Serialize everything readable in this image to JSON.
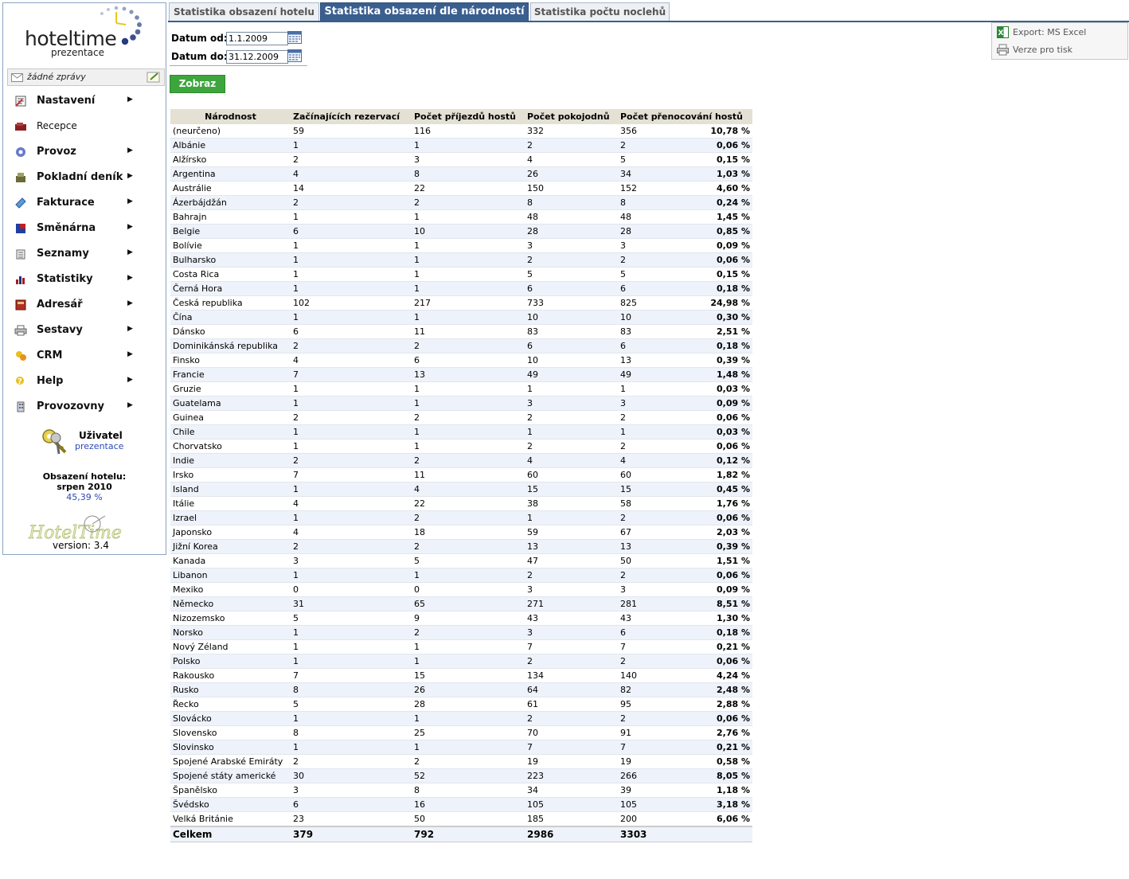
{
  "brand": {
    "name": "hoteltime",
    "sub": "prezentace"
  },
  "messages": {
    "text": "žádné zprávy"
  },
  "menu": [
    {
      "label": "Nastavení",
      "icon": "settings-icon",
      "submenu": true
    },
    {
      "label": "Recepce",
      "icon": "reception-icon",
      "submenu": false
    },
    {
      "label": "Provoz",
      "icon": "gear-icon",
      "submenu": true
    },
    {
      "label": "Pokladní deník",
      "icon": "cash-register-icon",
      "submenu": true
    },
    {
      "label": "Fakturace",
      "icon": "invoice-icon",
      "submenu": true
    },
    {
      "label": "Směnárna",
      "icon": "exchange-flag-icon",
      "submenu": true
    },
    {
      "label": "Seznamy",
      "icon": "list-icon",
      "submenu": true
    },
    {
      "label": "Statistiky",
      "icon": "bar-chart-icon",
      "submenu": true
    },
    {
      "label": "Adresář",
      "icon": "address-book-icon",
      "submenu": true
    },
    {
      "label": "Sestavy",
      "icon": "printer-icon",
      "submenu": true
    },
    {
      "label": "CRM",
      "icon": "crm-icon",
      "submenu": true
    },
    {
      "label": "Help",
      "icon": "help-icon",
      "submenu": true
    },
    {
      "label": "Provozovny",
      "icon": "building-icon",
      "submenu": true
    }
  ],
  "user": {
    "title": "Uživatel",
    "name": "prezentace"
  },
  "occupancy": {
    "line1": "Obsazení hotelu:",
    "line2": "srpen 2010",
    "value": "45,39 %"
  },
  "version": {
    "text": "version: 3.4",
    "logo": "HotelTime"
  },
  "tabs": [
    {
      "label": "Statistika obsazení hotelu",
      "active": false
    },
    {
      "label": "Statistika obsazení dle národností",
      "active": true
    },
    {
      "label": "Statistika počtu noclehů",
      "active": false
    }
  ],
  "filter": {
    "from_label": "Datum od:",
    "from_value": "1.1.2009",
    "to_label": "Datum do:",
    "to_value": "31.12.2009",
    "submit": "Zobraz"
  },
  "export": {
    "excel": "Export: MS Excel",
    "print": "Verze pro tisk"
  },
  "table": {
    "columns": [
      "Národnost",
      "Začínajících rezervací",
      "Počet příjezdů hostů",
      "Počet pokojodnů",
      "Počet přenocování hostů",
      ""
    ],
    "rows": [
      [
        "(neurčeno)",
        "59",
        "116",
        "332",
        "356",
        "10,78 %"
      ],
      [
        "Albánie",
        "1",
        "1",
        "2",
        "2",
        "0,06 %"
      ],
      [
        "Alžírsko",
        "2",
        "3",
        "4",
        "5",
        "0,15 %"
      ],
      [
        "Argentina",
        "4",
        "8",
        "26",
        "34",
        "1,03 %"
      ],
      [
        "Austrálie",
        "14",
        "22",
        "150",
        "152",
        "4,60 %"
      ],
      [
        "Ázerbájdžán",
        "2",
        "2",
        "8",
        "8",
        "0,24 %"
      ],
      [
        "Bahrajn",
        "1",
        "1",
        "48",
        "48",
        "1,45 %"
      ],
      [
        "Belgie",
        "6",
        "10",
        "28",
        "28",
        "0,85 %"
      ],
      [
        "Bolívie",
        "1",
        "1",
        "3",
        "3",
        "0,09 %"
      ],
      [
        "Bulharsko",
        "1",
        "1",
        "2",
        "2",
        "0,06 %"
      ],
      [
        "Costa Rica",
        "1",
        "1",
        "5",
        "5",
        "0,15 %"
      ],
      [
        "Černá Hora",
        "1",
        "1",
        "6",
        "6",
        "0,18 %"
      ],
      [
        "Česká republika",
        "102",
        "217",
        "733",
        "825",
        "24,98 %"
      ],
      [
        "Čína",
        "1",
        "1",
        "10",
        "10",
        "0,30 %"
      ],
      [
        "Dánsko",
        "6",
        "11",
        "83",
        "83",
        "2,51 %"
      ],
      [
        "Dominikánská republika",
        "2",
        "2",
        "6",
        "6",
        "0,18 %"
      ],
      [
        "Finsko",
        "4",
        "6",
        "10",
        "13",
        "0,39 %"
      ],
      [
        "Francie",
        "7",
        "13",
        "49",
        "49",
        "1,48 %"
      ],
      [
        "Gruzie",
        "1",
        "1",
        "1",
        "1",
        "0,03 %"
      ],
      [
        "Guatelama",
        "1",
        "1",
        "3",
        "3",
        "0,09 %"
      ],
      [
        "Guinea",
        "2",
        "2",
        "2",
        "2",
        "0,06 %"
      ],
      [
        "Chile",
        "1",
        "1",
        "1",
        "1",
        "0,03 %"
      ],
      [
        "Chorvatsko",
        "1",
        "1",
        "2",
        "2",
        "0,06 %"
      ],
      [
        "Indie",
        "2",
        "2",
        "4",
        "4",
        "0,12 %"
      ],
      [
        "Irsko",
        "7",
        "11",
        "60",
        "60",
        "1,82 %"
      ],
      [
        "Island",
        "1",
        "4",
        "15",
        "15",
        "0,45 %"
      ],
      [
        "Itálie",
        "4",
        "22",
        "38",
        "58",
        "1,76 %"
      ],
      [
        "Izrael",
        "1",
        "2",
        "1",
        "2",
        "0,06 %"
      ],
      [
        "Japonsko",
        "4",
        "18",
        "59",
        "67",
        "2,03 %"
      ],
      [
        "Jižní Korea",
        "2",
        "2",
        "13",
        "13",
        "0,39 %"
      ],
      [
        "Kanada",
        "3",
        "5",
        "47",
        "50",
        "1,51 %"
      ],
      [
        "Libanon",
        "1",
        "1",
        "2",
        "2",
        "0,06 %"
      ],
      [
        "Mexiko",
        "0",
        "0",
        "3",
        "3",
        "0,09 %"
      ],
      [
        "Německo",
        "31",
        "65",
        "271",
        "281",
        "8,51 %"
      ],
      [
        "Nizozemsko",
        "5",
        "9",
        "43",
        "43",
        "1,30 %"
      ],
      [
        "Norsko",
        "1",
        "2",
        "3",
        "6",
        "0,18 %"
      ],
      [
        "Nový Zéland",
        "1",
        "1",
        "7",
        "7",
        "0,21 %"
      ],
      [
        "Polsko",
        "1",
        "1",
        "2",
        "2",
        "0,06 %"
      ],
      [
        "Rakousko",
        "7",
        "15",
        "134",
        "140",
        "4,24 %"
      ],
      [
        "Rusko",
        "8",
        "26",
        "64",
        "82",
        "2,48 %"
      ],
      [
        "Řecko",
        "5",
        "28",
        "61",
        "95",
        "2,88 %"
      ],
      [
        "Slovácko",
        "1",
        "1",
        "2",
        "2",
        "0,06 %"
      ],
      [
        "Slovensko",
        "8",
        "25",
        "70",
        "91",
        "2,76 %"
      ],
      [
        "Slovinsko",
        "1",
        "1",
        "7",
        "7",
        "0,21 %"
      ],
      [
        "Spojené Arabské Emiráty",
        "2",
        "2",
        "19",
        "19",
        "0,58 %"
      ],
      [
        "Spojené státy americké",
        "30",
        "52",
        "223",
        "266",
        "8,05 %"
      ],
      [
        "Španělsko",
        "3",
        "8",
        "34",
        "39",
        "1,18 %"
      ],
      [
        "Švédsko",
        "6",
        "16",
        "105",
        "105",
        "3,18 %"
      ],
      [
        "Velká Británie",
        "23",
        "50",
        "185",
        "200",
        "6,06 %"
      ]
    ],
    "total": [
      "Celkem",
      "379",
      "792",
      "2986",
      "3303",
      ""
    ]
  }
}
